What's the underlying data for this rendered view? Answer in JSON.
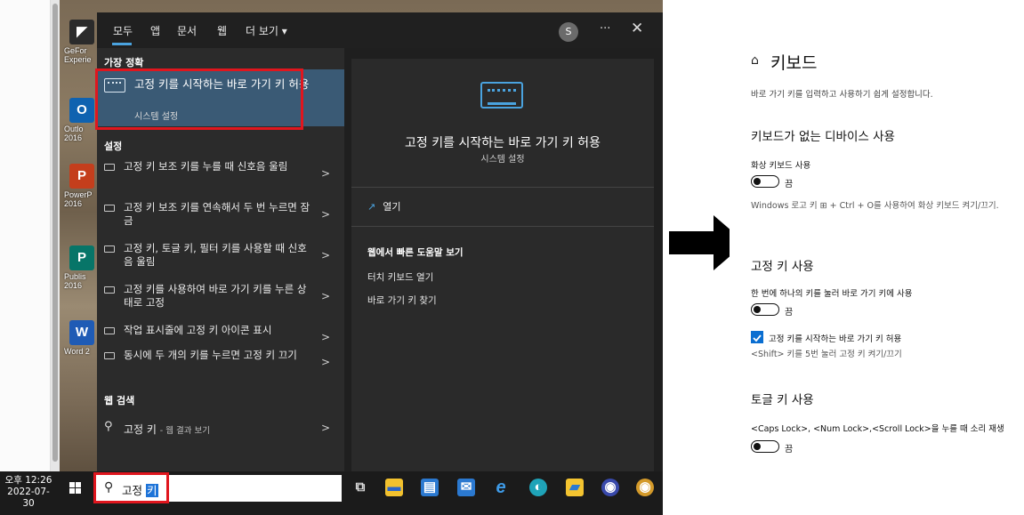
{
  "desktop": {
    "icons": [
      {
        "name": "geforce",
        "label": "GeFor\nExperie",
        "color": "#2b2b2b",
        "glyph": ""
      },
      {
        "name": "outlook",
        "label": "Outlo\n2016",
        "color": "#0f62b0",
        "glyph": "O"
      },
      {
        "name": "powerpoint",
        "label": "PowerP\n2016",
        "color": "#c43e1c",
        "glyph": "P"
      },
      {
        "name": "publisher",
        "label": "Publis\n2016",
        "color": "#077568",
        "glyph": "P"
      },
      {
        "name": "word",
        "label": "Word 2",
        "color": "#1f5bb5",
        "glyph": "W"
      }
    ]
  },
  "search_panel": {
    "tabs": [
      "모두",
      "앱",
      "문서",
      "웹",
      "더 보기 ▾"
    ],
    "avatar_letter": "S",
    "more": "···",
    "close": "✕",
    "best_match": {
      "section": "가장 정확",
      "title": "고정 키를 시작하는 바로 가기 키 허용",
      "subtitle": "시스템 설정"
    },
    "settings_section": "설정",
    "settings_items": [
      "고정 키 보조 키를 누를 때 신호음 울림",
      "고정 키 보조 키를 연속해서 두 번 누르면 잠금",
      "고정 키, 토글 키, 필터 키를 사용할 때 신호음 울림",
      "고정 키를 사용하여 바로 가기 키를 누른 상태로 고정",
      "작업 표시줄에 고정 키 아이콘 표시",
      "동시에 두 개의 키를 누르면 고정 키 끄기"
    ],
    "web_section": "웹 검색",
    "web_item": {
      "query": "고정 키",
      "suffix": "- 웹 결과 보기"
    },
    "preview": {
      "title": "고정 키를 시작하는 바로 가기 키 허용",
      "subtitle": "시스템 설정",
      "open": "열기",
      "help_title": "웹에서 빠른 도움말 보기",
      "help_links": [
        "터치 키보드 열기",
        "바로 가기 키 찾기"
      ]
    }
  },
  "taskbar": {
    "time": "오후 12:26",
    "date": "2022-07-30",
    "search_prefix": "고정 ",
    "search_selected": "키",
    "apps": [
      {
        "name": "task-view",
        "color": "#1b1b1b",
        "glyph": "⧉"
      },
      {
        "name": "file-explorer",
        "color": "#f2c12e",
        "glyph": "▬"
      },
      {
        "name": "store",
        "color": "#2b79d0",
        "glyph": "▤"
      },
      {
        "name": "mail",
        "color": "#2b79d0",
        "glyph": "✉"
      },
      {
        "name": "internet-explorer",
        "color": "#1b1b1b",
        "glyph": "e"
      },
      {
        "name": "edge",
        "color": "#1fa3b8",
        "glyph": "●"
      },
      {
        "name": "sticky-notes",
        "color": "#f4c430",
        "glyph": "▰"
      },
      {
        "name": "chrome-canary-1",
        "color": "#3949ab",
        "glyph": "◉"
      },
      {
        "name": "chrome-canary-2",
        "color": "#d49a2a",
        "glyph": "◉"
      }
    ]
  },
  "settings": {
    "home_icon": "⌂",
    "title": "키보드",
    "description": "바로 가기 키를 입력하고 사용하기 쉽게 설정합니다.",
    "section1": "키보드가 없는 디바이스 사용",
    "onscreen_label": "화상 키보드 사용",
    "onscreen_state": "끔",
    "onscreen_note": "Windows 로고 키 ⊞ + Ctrl + O를 사용하여 화상 키보드 켜기/끄기.",
    "section2": "고정 키 사용",
    "sticky_label": "한 번에 하나의 키를 눌러 바로 가기 키에 사용",
    "sticky_state": "끔",
    "sticky_checkbox": "고정 키를 시작하는 바로 가기 키 허용",
    "sticky_note": "<Shift> 키를 5번 눌러 고정 키 켜기/끄기",
    "section3": "토글 키 사용",
    "toggle_label": "<Caps Lock>, <Num Lock>,<Scroll Lock>을 누를 때 소리 재생",
    "toggle_state": "끔"
  }
}
